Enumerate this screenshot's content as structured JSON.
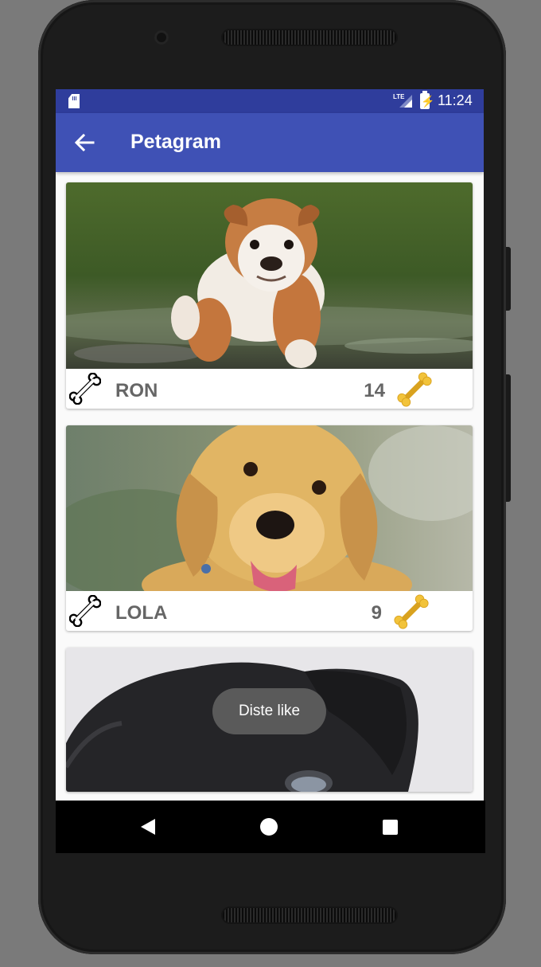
{
  "status_bar": {
    "time": "11:24",
    "network_label": "LTE",
    "icons": [
      "sd-card-icon",
      "lte-signal-icon",
      "battery-charging-icon"
    ]
  },
  "app_bar": {
    "title": "Petagram",
    "back_icon": "arrow-back-icon"
  },
  "pets": [
    {
      "name": "RON",
      "likes": "14",
      "photo": "bulldog-puppy-photo",
      "bone_icon": "bone-outline-icon",
      "like_icon": "bone-gold-icon"
    },
    {
      "name": "LOLA",
      "likes": "9",
      "photo": "golden-retriever-puppy-photo",
      "bone_icon": "bone-outline-icon",
      "like_icon": "bone-gold-icon"
    },
    {
      "photo": "black-puppy-photo"
    }
  ],
  "toast": {
    "message": "Diste like"
  },
  "nav_bar": {
    "icons": [
      "nav-back-icon",
      "nav-home-icon",
      "nav-recents-icon"
    ]
  },
  "colors": {
    "primary": "#3f51b5",
    "primary_dark": "#2f3d9c",
    "accent_bone": "#f2c33a",
    "text_secondary": "#666666"
  }
}
